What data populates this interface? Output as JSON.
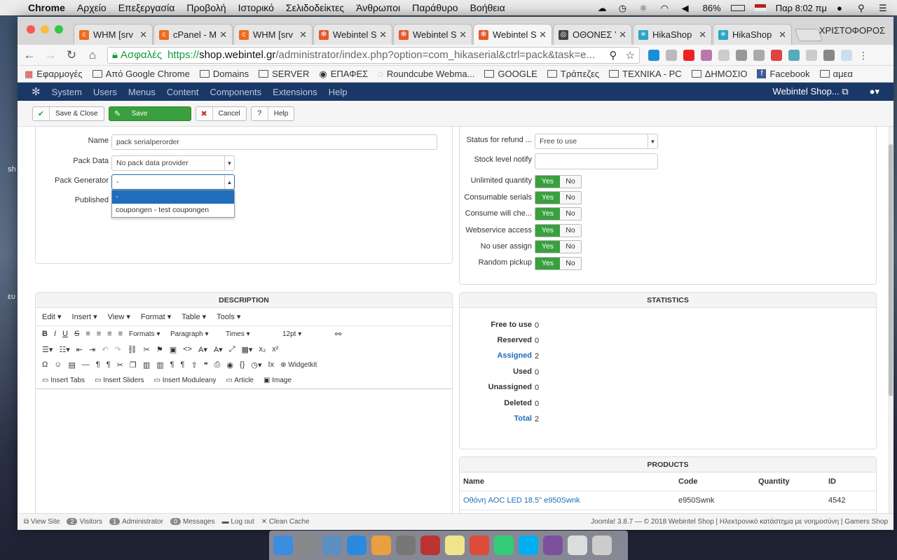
{
  "menubar": {
    "app": "Chrome",
    "items": [
      "Αρχείο",
      "Επεξεργασία",
      "Προβολή",
      "Ιστορικό",
      "Σελιδοδείκτες",
      "Άνθρωποι",
      "Παράθυρο",
      "Βοήθεια"
    ],
    "battery": "86%",
    "clock": "Παρ 8:02 πμ"
  },
  "tabs": [
    {
      "title": "WHM [srv",
      "icon": "cpanel"
    },
    {
      "title": "cPanel - M",
      "icon": "cpanel"
    },
    {
      "title": "WHM [srv",
      "icon": "cpanel"
    },
    {
      "title": "Webintel S",
      "icon": "joomla"
    },
    {
      "title": "Webintel S",
      "icon": "joomla"
    },
    {
      "title": "Webintel S",
      "icon": "joomla",
      "active": true
    },
    {
      "title": "ΟΘΟΝΕΣ Υ",
      "icon": "globe"
    },
    {
      "title": "HikaShop",
      "icon": "hika"
    },
    {
      "title": "HikaShop",
      "icon": "hika"
    }
  ],
  "profile": "ΧΡΙΣΤΟΦΟΡΟΣ",
  "address": {
    "secure": "Ασφαλές",
    "scheme": "https://",
    "host": "shop.webintel.gr",
    "path": "/administrator/index.php?option=com_hikaserial&ctrl=pack&task=e..."
  },
  "bookmarks": [
    "Εφαρμογές",
    "Από Google Chrome",
    "Domains",
    "SERVER",
    "ΕΠΑΦΕΣ",
    "Roundcube Webma...",
    "GOOGLE",
    "Τράπεζες",
    "ΤΕΧΝΙΚΑ - PC",
    "ΔΗΜΟΣΙΟ",
    "Facebook",
    "αμεα"
  ],
  "joomla": {
    "menu": [
      "System",
      "Users",
      "Menus",
      "Content",
      "Components",
      "Extensions",
      "Help"
    ],
    "site": "Webintel Shop..."
  },
  "toolbar": {
    "save_close": "Save & Close",
    "save": "Save",
    "cancel": "Cancel",
    "help": "Help"
  },
  "form": {
    "name_label": "Name",
    "name_value": "pack serialperorder",
    "pack_data_label": "Pack Data",
    "pack_data_value": "No pack data provider",
    "pack_generator_label": "Pack Generator",
    "pack_generator_value": "-",
    "published_label": "Published",
    "generator_options": [
      "-",
      "coupongen - test coupongen"
    ]
  },
  "options": {
    "status_refund_label": "Status for refund ...",
    "status_refund_value": "Free to use",
    "stock_label": "Stock level notify",
    "stock_value": "",
    "toggles": [
      {
        "label": "Unlimited quantity",
        "yes": "Yes",
        "no": "No"
      },
      {
        "label": "Consumable serials",
        "yes": "Yes",
        "no": "No"
      },
      {
        "label": "Consume will che...",
        "yes": "Yes",
        "no": "No"
      },
      {
        "label": "Webservice access",
        "yes": "Yes",
        "no": "No"
      },
      {
        "label": "No user assign",
        "yes": "Yes",
        "no": "No"
      },
      {
        "label": "Random pickup",
        "yes": "Yes",
        "no": "No"
      }
    ]
  },
  "description": {
    "title": "DESCRIPTION",
    "menu": [
      "Edit",
      "Insert",
      "View",
      "Format",
      "Table",
      "Tools"
    ],
    "formats": "Formats",
    "paragraph": "Paragraph",
    "font": "Times",
    "size": "12pt",
    "widgetkit": "Widgetkit",
    "row4": [
      "Insert Tabs",
      "Insert Sliders",
      "Insert Moduleany",
      "Article",
      "Image"
    ]
  },
  "statistics": {
    "title": "STATISTICS",
    "rows": [
      {
        "k": "Free to use",
        "v": "0"
      },
      {
        "k": "Reserved",
        "v": "0"
      },
      {
        "k": "Assigned",
        "v": "2",
        "link": true
      },
      {
        "k": "Used",
        "v": "0"
      },
      {
        "k": "Unassigned",
        "v": "0"
      },
      {
        "k": "Deleted",
        "v": "0"
      },
      {
        "k": "Total",
        "v": "2",
        "link": true
      }
    ]
  },
  "products": {
    "title": "PRODUCTS",
    "headers": [
      "Name",
      "Code",
      "Quantity",
      "ID"
    ],
    "rows": [
      {
        "name": "Οθόνη AOC LED 18.5\" e950Swnk",
        "code": "e950Swnk",
        "quantity": "",
        "id": "4542"
      }
    ]
  },
  "status": {
    "view_site": "View Site",
    "visitors_count": "2",
    "visitors": "Visitors",
    "admin_count": "1",
    "admin": "Administrator",
    "messages_count": "0",
    "messages": "Messages",
    "logout": "Log out",
    "clear": "Clean Cache",
    "footer": "Joomla! 3.8.7 — © 2018 Webintel Shop | Ηλεκτρονικό κατάστημα με νοημοσύνη | Gamers Shop"
  }
}
